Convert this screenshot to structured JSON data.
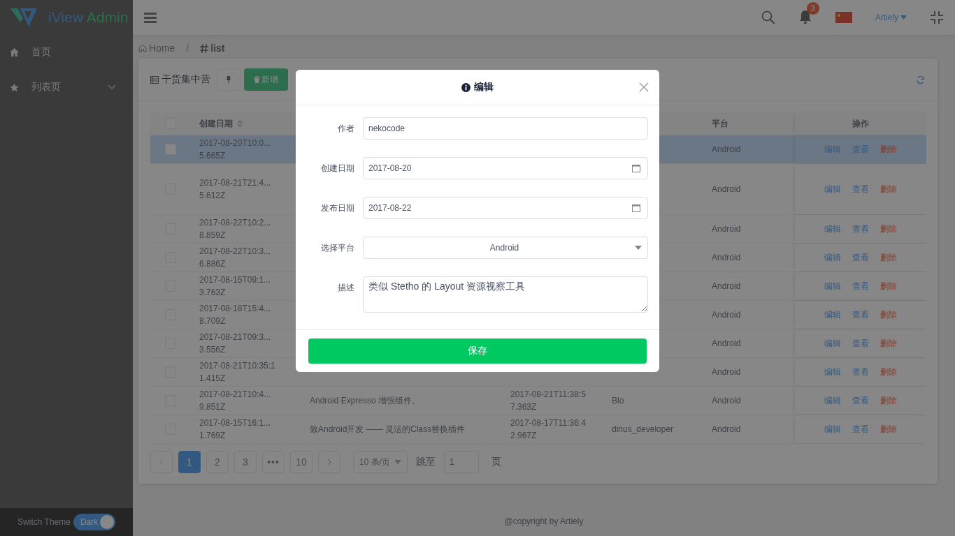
{
  "brand": [
    "iView",
    "Admin"
  ],
  "sidebar": {
    "items": [
      {
        "label": "首页",
        "expandable": false
      },
      {
        "label": "列表页",
        "expandable": true
      }
    ],
    "theme_label": "Switch Theme",
    "theme_switch": {
      "label": "Dark",
      "on": true
    }
  },
  "header": {
    "notifications": "3",
    "user": "Artiely"
  },
  "breadcrumb": [
    {
      "label": "Home"
    },
    {
      "label": "list"
    }
  ],
  "breadcrumb_separator": "/",
  "card": {
    "title": "干货集中营",
    "add_button": "新增"
  },
  "table": {
    "header": {
      "created": "创建日期",
      "platform": "平台",
      "actions": "操作"
    },
    "header_checked": false,
    "rows": [
      {
        "checked": false,
        "highlighted": true,
        "created": [
          "2017-08-20T10:0...",
          "5.665Z"
        ],
        "platform": "Android",
        "actions": [
          {
            "label": "编辑",
            "kind": "link"
          },
          {
            "label": "查看",
            "kind": "link"
          },
          {
            "label": "删除",
            "kind": "danger"
          }
        ]
      },
      {
        "checked": false,
        "highlighted": false,
        "created": [
          "2017-08-21T21:4...",
          "5.612Z"
        ],
        "platform": "Android",
        "actions": [
          {
            "label": "编辑",
            "kind": "link"
          },
          {
            "label": "查看",
            "kind": "link"
          },
          {
            "label": "删除",
            "kind": "danger"
          }
        ]
      },
      {
        "checked": false,
        "highlighted": false,
        "created": [
          "2017-08-22T10:2...",
          "8.859Z"
        ],
        "platform": "Android",
        "actions": [
          {
            "label": "编辑",
            "kind": "link"
          },
          {
            "label": "查看",
            "kind": "link"
          },
          {
            "label": "删除",
            "kind": "danger"
          }
        ]
      },
      {
        "checked": false,
        "highlighted": false,
        "created": [
          "2017-08-22T10:3...",
          "6.886Z"
        ],
        "platform": "Android",
        "actions": [
          {
            "label": "编辑",
            "kind": "link"
          },
          {
            "label": "查看",
            "kind": "link"
          },
          {
            "label": "删除",
            "kind": "danger"
          }
        ]
      },
      {
        "checked": false,
        "highlighted": false,
        "created": [
          "2017-08-15T09:1...",
          "3.763Z"
        ],
        "platform": "Android",
        "actions": [
          {
            "label": "编辑",
            "kind": "link"
          },
          {
            "label": "查看",
            "kind": "link"
          },
          {
            "label": "删除",
            "kind": "danger"
          }
        ]
      },
      {
        "checked": false,
        "highlighted": false,
        "created": [
          "2017-08-18T15:4...",
          "8.709Z"
        ],
        "platform": "Android",
        "actions": [
          {
            "label": "编辑",
            "kind": "link"
          },
          {
            "label": "查看",
            "kind": "link"
          },
          {
            "label": "删除",
            "kind": "danger"
          }
        ]
      },
      {
        "checked": false,
        "highlighted": false,
        "created": [
          "2017-08-21T09:3...",
          "3.556Z"
        ],
        "platform": "Android",
        "actions": [
          {
            "label": "编辑",
            "kind": "link"
          },
          {
            "label": "查看",
            "kind": "link"
          },
          {
            "label": "删除",
            "kind": "danger"
          }
        ]
      },
      {
        "checked": false,
        "highlighted": false,
        "created": [
          "2017-08-21T10:35:1",
          "1.415Z"
        ],
        "platform": "Android",
        "actions": [
          {
            "label": "编辑",
            "kind": "link"
          },
          {
            "label": "查看",
            "kind": "link"
          },
          {
            "label": "删除",
            "kind": "danger"
          }
        ]
      },
      {
        "checked": false,
        "highlighted": false,
        "created": [
          "2017-08-21T10:4...",
          "9.851Z"
        ],
        "title": "Android Expresso 增强组件。",
        "published": [
          "2017-08-21T11:38:5",
          "7.363Z"
        ],
        "author": "Blo",
        "platform": "Android",
        "actions": [
          {
            "label": "编辑",
            "kind": "link"
          },
          {
            "label": "查看",
            "kind": "link"
          },
          {
            "label": "删除",
            "kind": "danger"
          }
        ]
      },
      {
        "checked": false,
        "highlighted": false,
        "created": [
          "2017-08-15T16:1...",
          "1.769Z"
        ],
        "title": "致Android开发 —— 灵活的Class替换插件",
        "published": [
          "2017-08-17T11:36:4",
          "2.967Z"
        ],
        "author": "dinus_developer",
        "platform": "Android",
        "actions": [
          {
            "label": "编辑",
            "kind": "link"
          },
          {
            "label": "查看",
            "kind": "link"
          },
          {
            "label": "删除",
            "kind": "danger"
          }
        ]
      }
    ]
  },
  "pagination": {
    "pages": [
      {
        "label": "1",
        "kind": "page",
        "selected": true
      },
      {
        "label": "2",
        "kind": "page",
        "selected": false
      },
      {
        "label": "3",
        "kind": "page",
        "selected": false
      },
      {
        "label": "•••",
        "kind": "jump",
        "selected": false
      },
      {
        "label": "10",
        "kind": "page",
        "selected": false
      }
    ],
    "page_size": "10 条/页",
    "goto_label": "跳至",
    "goto_value": "1",
    "goto_suffix": "页"
  },
  "footer": "@copyright by Artiely",
  "modal": {
    "title": "编辑",
    "fields": [
      {
        "label": "作者",
        "kind": "text",
        "value": "nekocode"
      },
      {
        "label": "创建日期",
        "kind": "date",
        "value": "2017-08-20"
      },
      {
        "label": "发布日期",
        "kind": "date",
        "value": "2017-08-22"
      },
      {
        "label": "选择平台",
        "kind": "select",
        "value": "Android"
      },
      {
        "label": "描述",
        "kind": "textarea",
        "value": "类似 Stetho 的 Layout 资源视察工具"
      }
    ],
    "save_button": "保存"
  }
}
